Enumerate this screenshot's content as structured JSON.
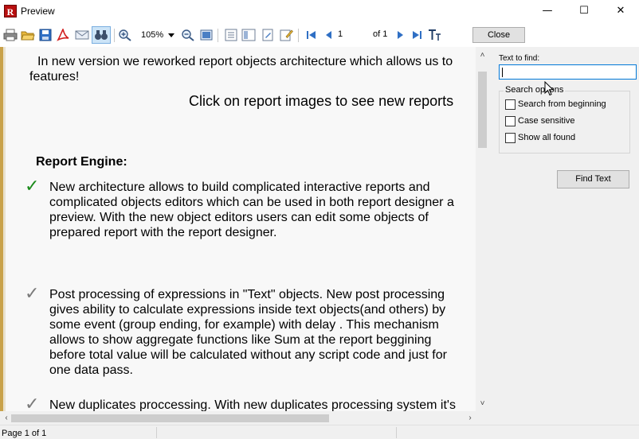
{
  "window": {
    "title": "Preview",
    "app_icon_letter": "R",
    "minimize_glyph": "—",
    "maximize_glyph": "☐",
    "close_glyph": "✕"
  },
  "toolbar": {
    "zoom_value": "105%",
    "page_value": "1",
    "page_of": "of 1",
    "close_label": "Close",
    "icons": [
      "print-icon",
      "open-icon",
      "save-icon",
      "pdf-export-icon",
      "email-icon",
      "find-icon",
      "zoom-in-icon",
      "zoom-out-icon",
      "full-screen-icon",
      "outline-icon",
      "thumbnails-icon",
      "page-setup-icon",
      "edit-icon",
      "first-page-icon",
      "prev-page-icon",
      "next-page-icon",
      "last-page-icon",
      "text-tool-icon"
    ]
  },
  "report": {
    "intro_line1": "In new version we reworked report objects architecture which allows us to",
    "intro_line2": "features!",
    "click_hint": "Click on report images to see new reports",
    "section_heading": "Report Engine:",
    "features": [
      {
        "check_color": "#1a8a1a",
        "text": "New architecture allows to build complicated interactive reports and\ncomplicated objects editors which can be used in both report designer a\npreview. With the new object editors users can edit some objects of\nprepared report with the report designer."
      },
      {
        "check_color": "#7a7a7a",
        "text": "Post processing of expressions in \"Text\" objects. New post processing\ngives ability to calculate expressions inside text objects(and others) by\nsome event (group ending, for example) with delay . This mechanism\nallows to show aggregate functions like Sum at the report beggining\nbefore total value will be calculated without any script code and just for\none data pass."
      },
      {
        "check_color": "#7a7a7a",
        "text": "New duplicates proccessing. With new duplicates processing system it's"
      }
    ]
  },
  "find_panel": {
    "text_to_find_label": "Text to find:",
    "text_to_find_value": "",
    "search_options_legend": "Search options",
    "options": [
      {
        "label": "Search from beginning",
        "checked": false
      },
      {
        "label": "Case sensitive",
        "checked": false
      },
      {
        "label": "Show all found",
        "checked": false
      }
    ],
    "find_button_label": "Find Text"
  },
  "status": {
    "page_text": "Page 1 of 1"
  }
}
